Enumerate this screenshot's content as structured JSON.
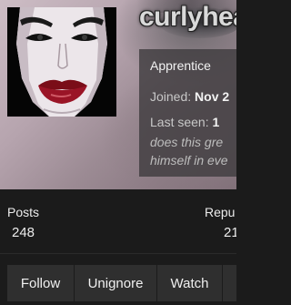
{
  "profile": {
    "username": "curlyhead",
    "rank": "Apprentice",
    "joined_label": "Joined:",
    "joined_value": "Nov 2",
    "last_seen_label": "Last seen:",
    "last_seen_value": "1",
    "status_line_1": "does this gre",
    "status_line_2": "himself in eve"
  },
  "stats": {
    "posts_label": "Posts",
    "posts_value": "248",
    "reputation_label": "Repu",
    "reputation_value": "21"
  },
  "actions": {
    "follow": "Follow",
    "unignore": "Unignore",
    "watch": "Watch"
  },
  "colors": {
    "background": "#1b1b1b",
    "button": "#2f2f2f",
    "info_card": "#3c3a3c",
    "lips": "#8b0f1c"
  }
}
